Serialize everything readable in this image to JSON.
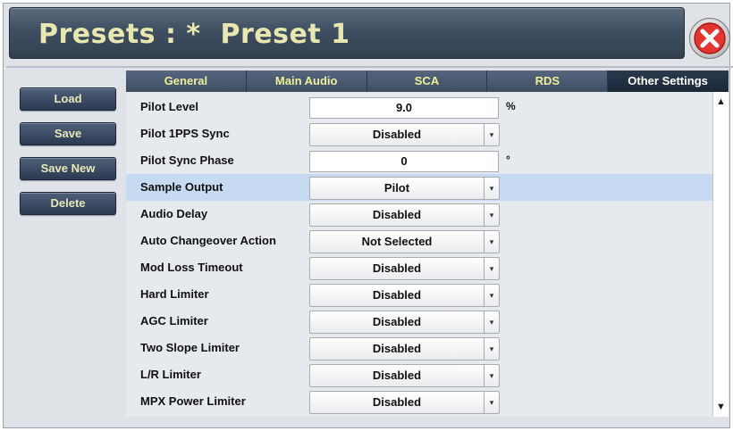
{
  "header": {
    "title": "Presets : *  Preset 1",
    "close_icon": "close-icon"
  },
  "sidebar": {
    "load": "Load",
    "save": "Save",
    "save_new": "Save New",
    "delete": "Delete"
  },
  "tabs": [
    "General",
    "Main Audio",
    "SCA",
    "RDS",
    "Other Settings"
  ],
  "active_tab": "Other Settings",
  "rows": [
    {
      "label": "Pilot Level",
      "type": "input",
      "value": "9.0",
      "unit": "%"
    },
    {
      "label": "Pilot 1PPS Sync",
      "type": "select",
      "value": "Disabled"
    },
    {
      "label": "Pilot Sync Phase",
      "type": "input",
      "value": "0",
      "unit": "°"
    },
    {
      "label": "Sample Output",
      "type": "select",
      "value": "Pilot",
      "highlighted": true
    },
    {
      "label": "Audio Delay",
      "type": "select",
      "value": "Disabled"
    },
    {
      "label": "Auto Changeover Action",
      "type": "select",
      "value": "Not Selected"
    },
    {
      "label": "Mod Loss Timeout",
      "type": "select",
      "value": "Disabled"
    },
    {
      "label": "Hard Limiter",
      "type": "select",
      "value": "Disabled"
    },
    {
      "label": "AGC Limiter",
      "type": "select",
      "value": "Disabled"
    },
    {
      "label": "Two Slope Limiter",
      "type": "select",
      "value": "Disabled"
    },
    {
      "label": "L/R Limiter",
      "type": "select",
      "value": "Disabled"
    },
    {
      "label": "MPX Power Limiter",
      "type": "select",
      "value": "Disabled"
    }
  ],
  "scrollbar": {
    "up": "▲",
    "down": "▼"
  },
  "colors": {
    "accent_text": "#e9e8b8",
    "highlight_row": "#c6dbf2",
    "close_red": "#e3342f"
  }
}
